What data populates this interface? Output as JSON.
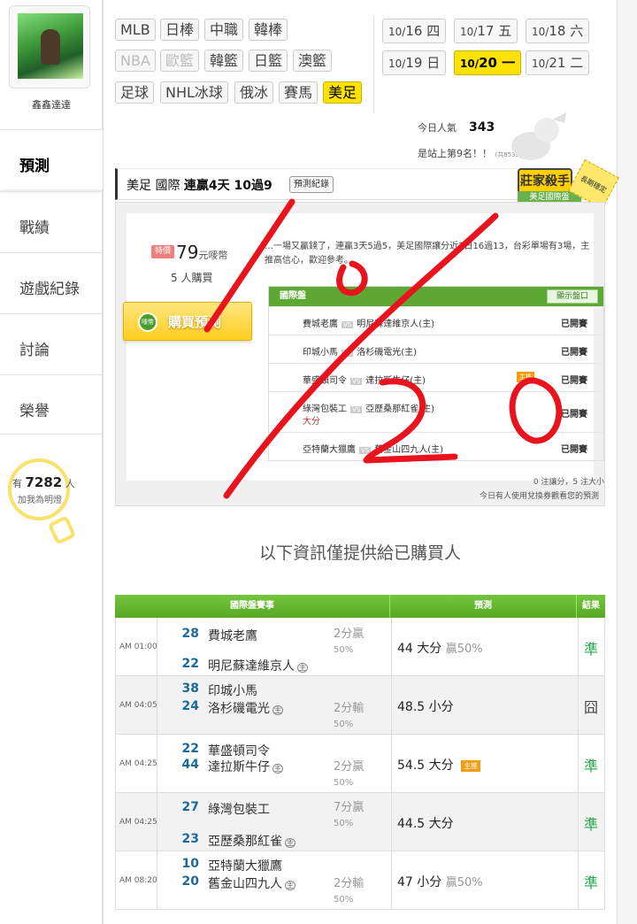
{
  "sidebar": {
    "username": "鑫鑫達達",
    "nav": [
      "預測",
      "戰績",
      "遊戲紀錄",
      "討論",
      "榮譽"
    ],
    "lamp": {
      "prefix": "有",
      "count": "7282",
      "suffix": "人",
      "caption": "加我為明燈"
    }
  },
  "sports": {
    "row1": [
      "MLB",
      "日棒",
      "中職",
      "韓棒"
    ],
    "row2": [
      "NBA",
      "歐籃",
      "韓籃",
      "日籃",
      "澳籃"
    ],
    "row3": [
      "足球",
      "NHL冰球",
      "俄冰",
      "賽馬",
      "美足"
    ]
  },
  "dates": [
    {
      "md": "10/",
      "d": "16",
      "w": "四"
    },
    {
      "md": "10/",
      "d": "17",
      "w": "五"
    },
    {
      "md": "10/",
      "d": "18",
      "w": "六"
    },
    {
      "md": "10/",
      "d": "19",
      "w": "日"
    },
    {
      "md": "10/",
      "d": "20",
      "w": "一"
    },
    {
      "md": "10/",
      "d": "21",
      "w": "二"
    }
  ],
  "popularity": {
    "label": "今日人氣",
    "value": "343",
    "rank": "是站上第9名！！",
    "total": "(共8532人)"
  },
  "prediction": {
    "category": "美足 國際",
    "streak": "連贏4天 10過9",
    "record_button": "預測紀錄",
    "badge_main": "莊家殺手",
    "badge_sub": "美足國際盤",
    "badge_side": "長期穩定"
  },
  "preview": {
    "price_tag": "特價",
    "price": "79",
    "price_unit": "元嘜幣",
    "buyers": "5 人購買",
    "buy_icon": "嘜幣",
    "buy_label": "購買預測",
    "desc": "…一場又贏錢了，連贏3天5過5，美足國際讓分近7日16過13，台彩單場有3場，主推高信心，歡迎參考。",
    "table_title": "國際盤",
    "show_button": "顯示盤口",
    "rows": [
      {
        "home": "費城老鷹",
        "away": "明尼蘇達維京人(主)",
        "status": "已開賽"
      },
      {
        "home": "印城小馬",
        "away": "洛杉磯電光(主)",
        "status": "已開賽"
      },
      {
        "home": "華盛頓司令",
        "away": "達拉斯牛仔(主)",
        "status": "已開賽",
        "tag": "主推"
      },
      {
        "home": "綠灣包裝工",
        "away": "亞歷桑那紅雀(主)",
        "status": "已開賽",
        "sub": "大分"
      },
      {
        "home": "亞特蘭大獵鷹",
        "away": "舊金山四九人(主)",
        "status": "已開賽"
      }
    ],
    "vs_label": "VS",
    "footer1": "0 注讓分，5 注大小",
    "footer2": "今日有人使用兌換券觀看您的預測"
  },
  "info_note": "以下資訊僅提供給已購買人",
  "table": {
    "headers": [
      "國際盤賽事",
      "預測",
      "結果"
    ],
    "home_mark": "主",
    "rows": [
      {
        "time": "AM 01:00",
        "s1": "28",
        "t1": "費城老鷹",
        "s2": "22",
        "t2": "明尼蘇達維京人",
        "hc": "2分贏",
        "hcp": "50%",
        "pick": "44 大分",
        "pickx": "贏50%",
        "res": "準"
      },
      {
        "time": "AM 04:05",
        "s1": "38",
        "t1": "印城小馬",
        "s2": "24",
        "t2": "洛杉磯電光",
        "hc": "2分輸",
        "hcp": "50%",
        "pick": "48.5 小分",
        "pickx": "",
        "res": "囧"
      },
      {
        "time": "AM 04:25",
        "s1": "22",
        "t1": "華盛頓司令",
        "s2": "44",
        "t2": "達拉斯牛仔",
        "hc": "2分贏",
        "hcp": "50%",
        "pick": "54.5 大分",
        "pickx": "",
        "tag": "主推",
        "res": "準"
      },
      {
        "time": "AM 04:25",
        "s1": "27",
        "t1": "綠灣包裝工",
        "s2": "23",
        "t2": "亞歷桑那紅雀",
        "hc": "7分贏",
        "hcp": "50%",
        "pick": "44.5 大分",
        "pickx": "",
        "res": "準"
      },
      {
        "time": "AM 08:20",
        "s1": "10",
        "t1": "亞特蘭大獵鷹",
        "s2": "20",
        "t2": "舊金山四九人",
        "hc": "2分輸",
        "hcp": "50%",
        "pick": "47 小分",
        "pickx": "贏50%",
        "res": "準"
      }
    ]
  },
  "colors": {
    "accent": "#ffe300",
    "green": "#5ca833",
    "scribble": "#e8131c"
  }
}
